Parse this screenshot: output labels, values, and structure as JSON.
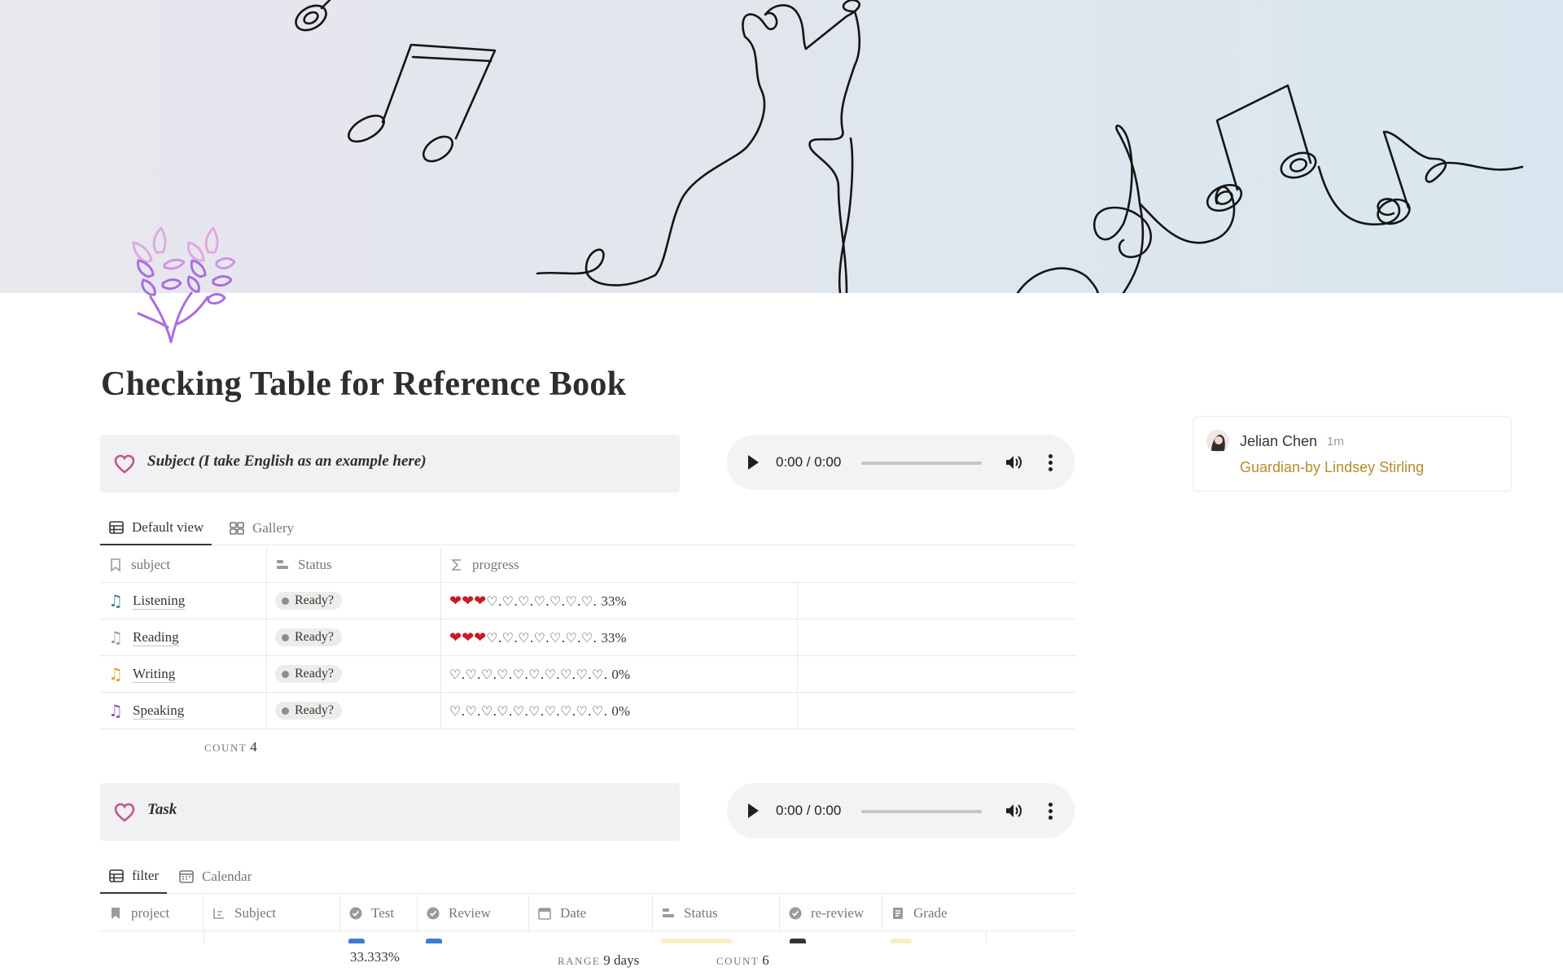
{
  "page": {
    "title": "Checking Table for Reference Book"
  },
  "subject_section": {
    "callout_text": "Subject  (I take English as an example here)",
    "audio_time": "0:00 / 0:00",
    "tabs": [
      {
        "label": "Default view",
        "icon": "table-icon",
        "active": true
      },
      {
        "label": "Gallery",
        "icon": "gallery-icon",
        "active": false
      }
    ],
    "columns": [
      {
        "label": "subject",
        "icon": "bookmark-icon"
      },
      {
        "label": "Status",
        "icon": "status-icon"
      },
      {
        "label": "progress",
        "icon": "formula-icon"
      }
    ],
    "rows": [
      {
        "subject": "Listening",
        "note_color": "#3b7ea1",
        "status": "Ready?",
        "hearts_full": "❤❤❤",
        "hearts_empty": "♡.♡.♡.♡.♡.♡.♡.",
        "percent": "33%"
      },
      {
        "subject": "Reading",
        "note_color": "#9b9a97",
        "status": "Ready?",
        "hearts_full": "❤❤❤",
        "hearts_empty": "♡.♡.♡.♡.♡.♡.♡.",
        "percent": "33%"
      },
      {
        "subject": "Writing",
        "note_color": "#d9a021",
        "status": "Ready?",
        "hearts_full": "",
        "hearts_empty": "♡.♡.♡.♡.♡.♡.♡.♡.♡.♡.",
        "percent": "0%"
      },
      {
        "subject": "Speaking",
        "note_color": "#8a52b8",
        "status": "Ready?",
        "hearts_full": "",
        "hearts_empty": "♡.♡.♡.♡.♡.♡.♡.♡.♡.♡.",
        "percent": "0%"
      }
    ],
    "count_label": "COUNT",
    "count_value": "4"
  },
  "task_section": {
    "callout_text": "Task",
    "audio_time": "0:00 / 0:00",
    "tabs": [
      {
        "label": "filter",
        "icon": "table-icon",
        "active": true
      },
      {
        "label": "Calendar",
        "icon": "calendar-icon",
        "active": false
      }
    ],
    "columns": [
      {
        "label": "project",
        "icon": "bookmark-icon"
      },
      {
        "label": "Subject",
        "icon": "relation-icon"
      },
      {
        "label": "Test",
        "icon": "checkbox-icon"
      },
      {
        "label": "Review",
        "icon": "checkbox-icon"
      },
      {
        "label": "Date",
        "icon": "calendar-icon"
      },
      {
        "label": "Status",
        "icon": "status-icon"
      },
      {
        "label": "re-review",
        "icon": "checkbox-icon"
      },
      {
        "label": "Grade",
        "icon": "grade-icon"
      }
    ],
    "footer": {
      "percent_value": "33.333%",
      "range_label": "RANGE",
      "range_value": "9 days",
      "count_label": "COUNT",
      "count_value": "6"
    }
  },
  "comment": {
    "author": "Jelian Chen",
    "time_ago": "1m",
    "link_text": "Guardian-by Lindsey Stirling"
  },
  "colors": {
    "heart_callout": "#c2548a",
    "heart_progress": "#c41d27",
    "link": "#b58b2a",
    "lavender": "#a96ee0"
  }
}
